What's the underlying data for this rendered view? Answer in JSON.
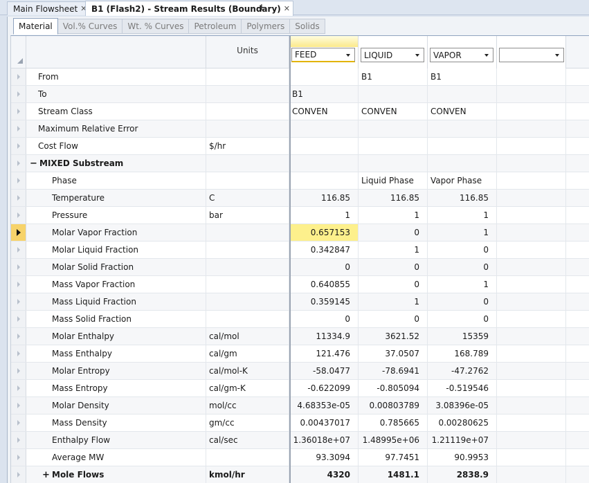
{
  "doc_tabs": [
    {
      "label": "Main Flowsheet",
      "active": false
    },
    {
      "label": "B1 (Flash2) - Stream Results (Boundary)",
      "active": true
    }
  ],
  "sub_tabs": [
    "Material",
    "Vol.% Curves",
    "Wt. % Curves",
    "Petroleum",
    "Polymers",
    "Solids"
  ],
  "units_header": "Units",
  "streams": [
    "FEED",
    "LIQUID",
    "VAPOR",
    ""
  ],
  "rows": [
    {
      "label": "From",
      "units": "",
      "values": [
        "",
        "B1",
        "B1",
        ""
      ]
    },
    {
      "label": "To",
      "units": "",
      "values": [
        "B1",
        "",
        "",
        ""
      ]
    },
    {
      "label": "Stream Class",
      "units": "",
      "values": [
        "CONVEN",
        "CONVEN",
        "CONVEN",
        ""
      ]
    },
    {
      "label": "Maximum Relative Error",
      "units": "",
      "values": [
        "",
        "",
        "",
        ""
      ]
    },
    {
      "label": "Cost Flow",
      "units": "$/hr",
      "values": [
        "",
        "",
        "",
        ""
      ]
    },
    {
      "label": "MIXED Substream",
      "units": "",
      "values": [
        "",
        "",
        "",
        ""
      ]
    },
    {
      "label": "Phase",
      "units": "",
      "values": [
        "",
        "Liquid Phase",
        "Vapor Phase",
        ""
      ]
    },
    {
      "label": "Temperature",
      "units": "C",
      "values": [
        "116.85",
        "116.85",
        "116.85",
        ""
      ]
    },
    {
      "label": "Pressure",
      "units": "bar",
      "values": [
        "1",
        "1",
        "1",
        ""
      ]
    },
    {
      "label": "Molar Vapor Fraction",
      "units": "",
      "values": [
        "0.657153",
        "0",
        "1",
        ""
      ]
    },
    {
      "label": "Molar Liquid Fraction",
      "units": "",
      "values": [
        "0.342847",
        "1",
        "0",
        ""
      ]
    },
    {
      "label": "Molar Solid Fraction",
      "units": "",
      "values": [
        "0",
        "0",
        "0",
        ""
      ]
    },
    {
      "label": "Mass Vapor Fraction",
      "units": "",
      "values": [
        "0.640855",
        "0",
        "1",
        ""
      ]
    },
    {
      "label": "Mass Liquid Fraction",
      "units": "",
      "values": [
        "0.359145",
        "1",
        "0",
        ""
      ]
    },
    {
      "label": "Mass Solid Fraction",
      "units": "",
      "values": [
        "0",
        "0",
        "0",
        ""
      ]
    },
    {
      "label": "Molar Enthalpy",
      "units": "cal/mol",
      "values": [
        "11334.9",
        "3621.52",
        "15359",
        ""
      ]
    },
    {
      "label": "Mass Enthalpy",
      "units": "cal/gm",
      "values": [
        "121.476",
        "37.0507",
        "168.789",
        ""
      ]
    },
    {
      "label": "Molar Entropy",
      "units": "cal/mol-K",
      "values": [
        "-58.0477",
        "-78.6941",
        "-47.2762",
        ""
      ]
    },
    {
      "label": "Mass Entropy",
      "units": "cal/gm-K",
      "values": [
        "-0.622099",
        "-0.805094",
        "-0.519546",
        ""
      ]
    },
    {
      "label": "Molar Density",
      "units": "mol/cc",
      "values": [
        "4.68353e-05",
        "0.00803789",
        "3.08396e-05",
        ""
      ]
    },
    {
      "label": "Mass Density",
      "units": "gm/cc",
      "values": [
        "0.00437017",
        "0.785665",
        "0.00280625",
        ""
      ]
    },
    {
      "label": "Enthalpy Flow",
      "units": "cal/sec",
      "values": [
        "1.36018e+07",
        "1.48995e+06",
        "1.21119e+07",
        ""
      ]
    },
    {
      "label": "Average MW",
      "units": "",
      "values": [
        "93.3094",
        "97.7451",
        "90.9953",
        ""
      ]
    },
    {
      "label": "Mole Flows",
      "units": "kmol/hr",
      "values": [
        "4320",
        "1481.1",
        "2838.9",
        ""
      ]
    }
  ]
}
